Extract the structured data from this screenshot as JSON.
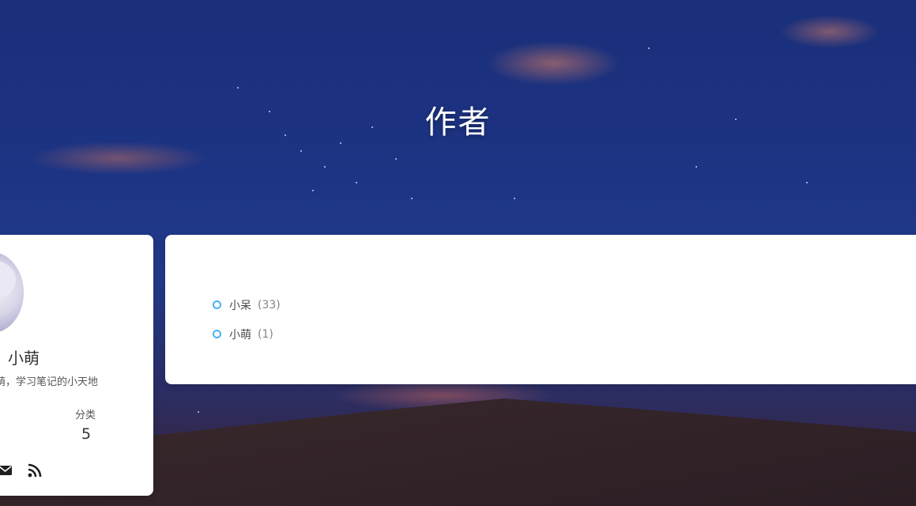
{
  "header": {
    "title": "作者"
  },
  "author_card": {
    "name": "小萌",
    "description": "萌，学习笔记的小天地",
    "stat_label": "分类",
    "stat_value": "5",
    "social": [
      {
        "icon": "envelope-icon"
      },
      {
        "icon": "rss-icon"
      }
    ]
  },
  "authors_list": [
    {
      "name": "小呆",
      "count": "(33)"
    },
    {
      "name": "小萌",
      "count": "(1)"
    }
  ],
  "colors": {
    "bullet": "#49b1f5",
    "card": "#ffffff",
    "sky": "#1d3484"
  }
}
